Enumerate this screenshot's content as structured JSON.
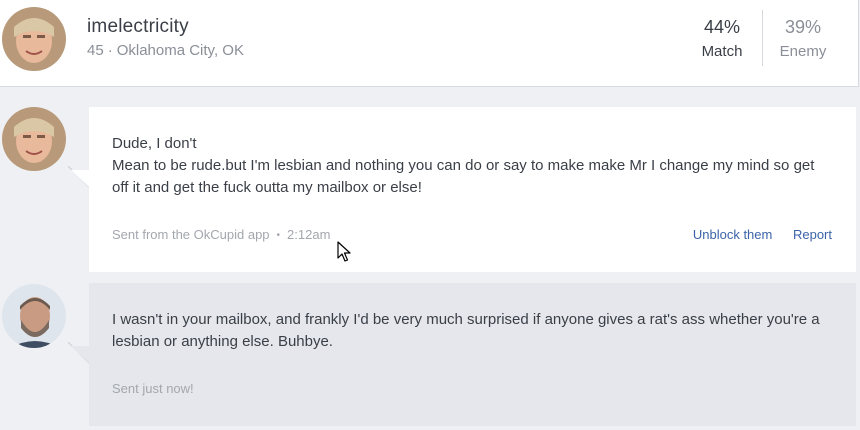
{
  "profile": {
    "username": "imelectricity",
    "age": "45",
    "separator": "·",
    "location": "Oklahoma City, OK",
    "match_percent": "44%",
    "match_label": "Match",
    "enemy_percent": "39%",
    "enemy_label": "Enemy"
  },
  "messages": [
    {
      "lines": [
        "Dude, I don't",
        "Mean to be rude.but I'm lesbian and nothing you can do or say to make make Mr I change my mind so get off it and get the fuck outta my mailbox or else!"
      ],
      "source": "Sent from the OkCupid app",
      "time": "2:12am",
      "actions": {
        "unblock": "Unblock them",
        "report": "Report"
      }
    },
    {
      "lines": [
        "I wasn't in your mailbox, and frankly I'd be very much surprised if anyone gives a rat's ass whether you're a lesbian or anything else. Buhbye."
      ],
      "status": "Sent just now!"
    }
  ],
  "colors": {
    "page_bg": "#eef0f4",
    "received_bubble": "#ffffff",
    "sent_bubble": "#e5e7ec",
    "link": "#3b63a8"
  }
}
